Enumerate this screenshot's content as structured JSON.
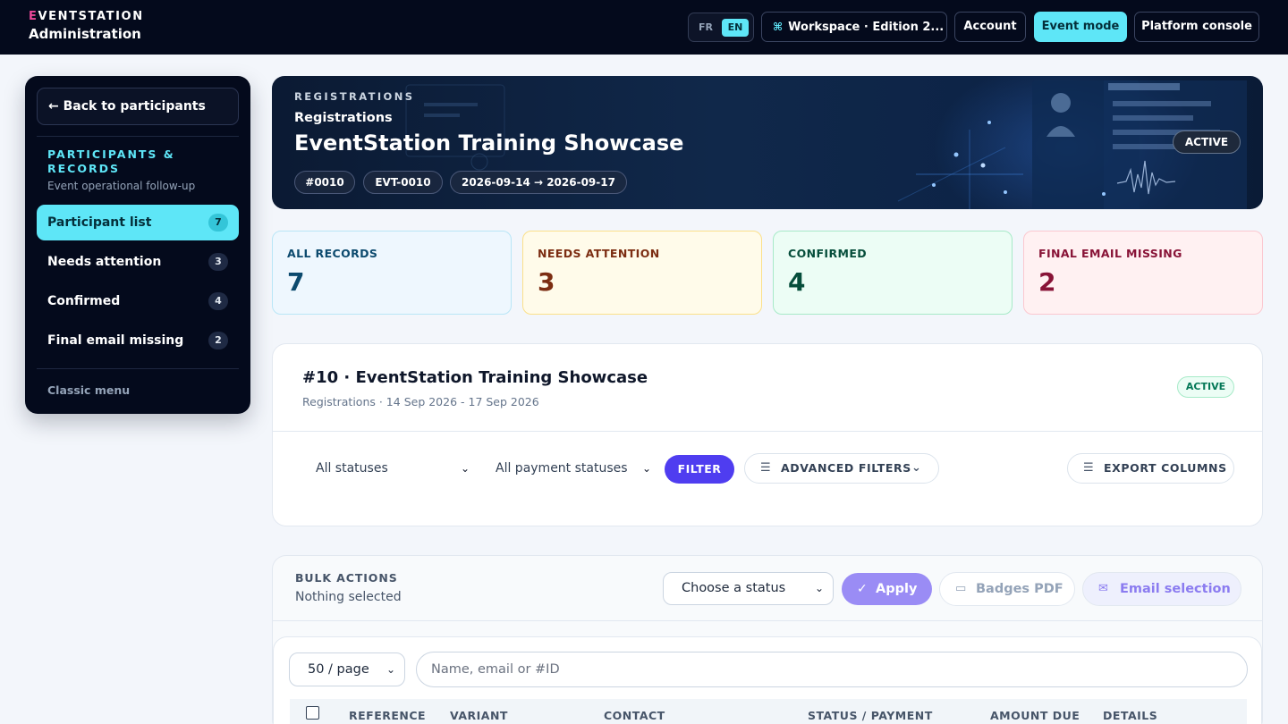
{
  "brand": {
    "logo_first": "E",
    "logo_rest": "VENTSTATION",
    "subtitle": "Administration"
  },
  "header": {
    "lang": {
      "fr": "FR",
      "en": "EN",
      "active": "EN"
    },
    "workspace_label": "Workspace · Edition 2...",
    "account_label": "Account",
    "event_mode_label": "Event mode",
    "platform_label": "Platform console"
  },
  "sidebar": {
    "back_label": "Back to participants",
    "section_title": "PARTICIPANTS & RECORDS",
    "section_subtitle": "Event operational follow-up",
    "items": [
      {
        "label": "Participant list",
        "count": "7",
        "active": true
      },
      {
        "label": "Needs attention",
        "count": "3",
        "active": false
      },
      {
        "label": "Confirmed",
        "count": "4",
        "active": false
      },
      {
        "label": "Final email missing",
        "count": "2",
        "active": false
      }
    ],
    "classic_menu": "Classic menu"
  },
  "hero": {
    "kicker": "REGISTRATIONS",
    "subtitle": "Registrations",
    "title": "EventStation Training Showcase",
    "chips": [
      "#0010",
      "EVT-0010",
      "2026-09-14 → 2026-09-17"
    ],
    "status": "ACTIVE"
  },
  "stats": [
    {
      "label": "ALL RECORDS",
      "value": "7"
    },
    {
      "label": "NEEDS ATTENTION",
      "value": "3"
    },
    {
      "label": "CONFIRMED",
      "value": "4"
    },
    {
      "label": "FINAL EMAIL MISSING",
      "value": "2"
    }
  ],
  "event_panel": {
    "title": "#10 · EventStation Training Showcase",
    "subtitle": "Registrations · 14 Sep 2026 - 17 Sep 2026",
    "badge": "ACTIVE",
    "status_select": "All statuses",
    "payment_select": "All payment statuses",
    "filter_label": "FILTER",
    "advanced_filters_label": "ADVANCED FILTERS",
    "export_columns_label": "EXPORT COLUMNS"
  },
  "bulk": {
    "label": "BULK ACTIONS",
    "selection_text": "Nothing selected",
    "status_select": "Choose a status",
    "apply_label": "Apply",
    "badges_label": "Badges PDF",
    "email_label": "Email selection"
  },
  "table": {
    "per_page": "50 / page",
    "search_placeholder": "Name, email or #ID",
    "columns": [
      "REFERENCE",
      "VARIANT",
      "CONTACT",
      "STATUS / PAYMENT",
      "AMOUNT DUE",
      "DETAILS"
    ]
  },
  "colors": {
    "topbar_bg": "#040a1c",
    "accent_cyan": "#5ee6f7",
    "filter_purple": "#4f3df0",
    "apply_purple": "#9a8cf5"
  }
}
